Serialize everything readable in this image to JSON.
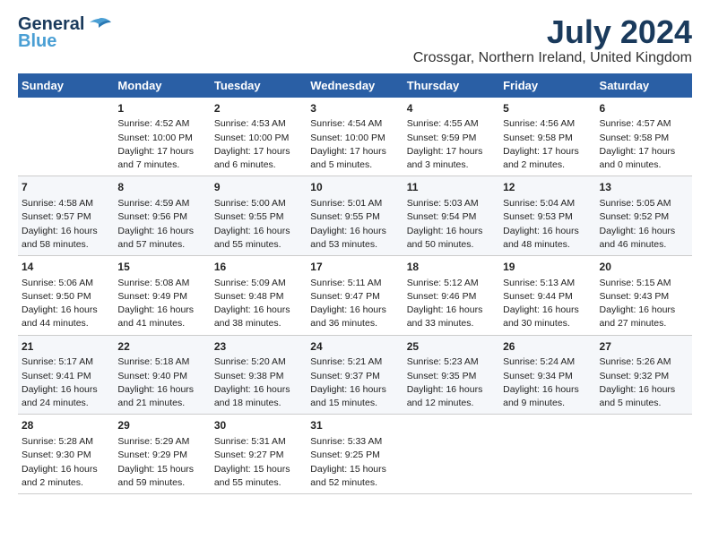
{
  "logo": {
    "line1": "General",
    "line2": "Blue"
  },
  "title": "July 2024",
  "subtitle": "Crossgar, Northern Ireland, United Kingdom",
  "header_days": [
    "Sunday",
    "Monday",
    "Tuesday",
    "Wednesday",
    "Thursday",
    "Friday",
    "Saturday"
  ],
  "weeks": [
    [
      {
        "day": "",
        "content": ""
      },
      {
        "day": "1",
        "content": "Sunrise: 4:52 AM\nSunset: 10:00 PM\nDaylight: 17 hours\nand 7 minutes."
      },
      {
        "day": "2",
        "content": "Sunrise: 4:53 AM\nSunset: 10:00 PM\nDaylight: 17 hours\nand 6 minutes."
      },
      {
        "day": "3",
        "content": "Sunrise: 4:54 AM\nSunset: 10:00 PM\nDaylight: 17 hours\nand 5 minutes."
      },
      {
        "day": "4",
        "content": "Sunrise: 4:55 AM\nSunset: 9:59 PM\nDaylight: 17 hours\nand 3 minutes."
      },
      {
        "day": "5",
        "content": "Sunrise: 4:56 AM\nSunset: 9:58 PM\nDaylight: 17 hours\nand 2 minutes."
      },
      {
        "day": "6",
        "content": "Sunrise: 4:57 AM\nSunset: 9:58 PM\nDaylight: 17 hours\nand 0 minutes."
      }
    ],
    [
      {
        "day": "7",
        "content": "Sunrise: 4:58 AM\nSunset: 9:57 PM\nDaylight: 16 hours\nand 58 minutes."
      },
      {
        "day": "8",
        "content": "Sunrise: 4:59 AM\nSunset: 9:56 PM\nDaylight: 16 hours\nand 57 minutes."
      },
      {
        "day": "9",
        "content": "Sunrise: 5:00 AM\nSunset: 9:55 PM\nDaylight: 16 hours\nand 55 minutes."
      },
      {
        "day": "10",
        "content": "Sunrise: 5:01 AM\nSunset: 9:55 PM\nDaylight: 16 hours\nand 53 minutes."
      },
      {
        "day": "11",
        "content": "Sunrise: 5:03 AM\nSunset: 9:54 PM\nDaylight: 16 hours\nand 50 minutes."
      },
      {
        "day": "12",
        "content": "Sunrise: 5:04 AM\nSunset: 9:53 PM\nDaylight: 16 hours\nand 48 minutes."
      },
      {
        "day": "13",
        "content": "Sunrise: 5:05 AM\nSunset: 9:52 PM\nDaylight: 16 hours\nand 46 minutes."
      }
    ],
    [
      {
        "day": "14",
        "content": "Sunrise: 5:06 AM\nSunset: 9:50 PM\nDaylight: 16 hours\nand 44 minutes."
      },
      {
        "day": "15",
        "content": "Sunrise: 5:08 AM\nSunset: 9:49 PM\nDaylight: 16 hours\nand 41 minutes."
      },
      {
        "day": "16",
        "content": "Sunrise: 5:09 AM\nSunset: 9:48 PM\nDaylight: 16 hours\nand 38 minutes."
      },
      {
        "day": "17",
        "content": "Sunrise: 5:11 AM\nSunset: 9:47 PM\nDaylight: 16 hours\nand 36 minutes."
      },
      {
        "day": "18",
        "content": "Sunrise: 5:12 AM\nSunset: 9:46 PM\nDaylight: 16 hours\nand 33 minutes."
      },
      {
        "day": "19",
        "content": "Sunrise: 5:13 AM\nSunset: 9:44 PM\nDaylight: 16 hours\nand 30 minutes."
      },
      {
        "day": "20",
        "content": "Sunrise: 5:15 AM\nSunset: 9:43 PM\nDaylight: 16 hours\nand 27 minutes."
      }
    ],
    [
      {
        "day": "21",
        "content": "Sunrise: 5:17 AM\nSunset: 9:41 PM\nDaylight: 16 hours\nand 24 minutes."
      },
      {
        "day": "22",
        "content": "Sunrise: 5:18 AM\nSunset: 9:40 PM\nDaylight: 16 hours\nand 21 minutes."
      },
      {
        "day": "23",
        "content": "Sunrise: 5:20 AM\nSunset: 9:38 PM\nDaylight: 16 hours\nand 18 minutes."
      },
      {
        "day": "24",
        "content": "Sunrise: 5:21 AM\nSunset: 9:37 PM\nDaylight: 16 hours\nand 15 minutes."
      },
      {
        "day": "25",
        "content": "Sunrise: 5:23 AM\nSunset: 9:35 PM\nDaylight: 16 hours\nand 12 minutes."
      },
      {
        "day": "26",
        "content": "Sunrise: 5:24 AM\nSunset: 9:34 PM\nDaylight: 16 hours\nand 9 minutes."
      },
      {
        "day": "27",
        "content": "Sunrise: 5:26 AM\nSunset: 9:32 PM\nDaylight: 16 hours\nand 5 minutes."
      }
    ],
    [
      {
        "day": "28",
        "content": "Sunrise: 5:28 AM\nSunset: 9:30 PM\nDaylight: 16 hours\nand 2 minutes."
      },
      {
        "day": "29",
        "content": "Sunrise: 5:29 AM\nSunset: 9:29 PM\nDaylight: 15 hours\nand 59 minutes."
      },
      {
        "day": "30",
        "content": "Sunrise: 5:31 AM\nSunset: 9:27 PM\nDaylight: 15 hours\nand 55 minutes."
      },
      {
        "day": "31",
        "content": "Sunrise: 5:33 AM\nSunset: 9:25 PM\nDaylight: 15 hours\nand 52 minutes."
      },
      {
        "day": "",
        "content": ""
      },
      {
        "day": "",
        "content": ""
      },
      {
        "day": "",
        "content": ""
      }
    ]
  ]
}
